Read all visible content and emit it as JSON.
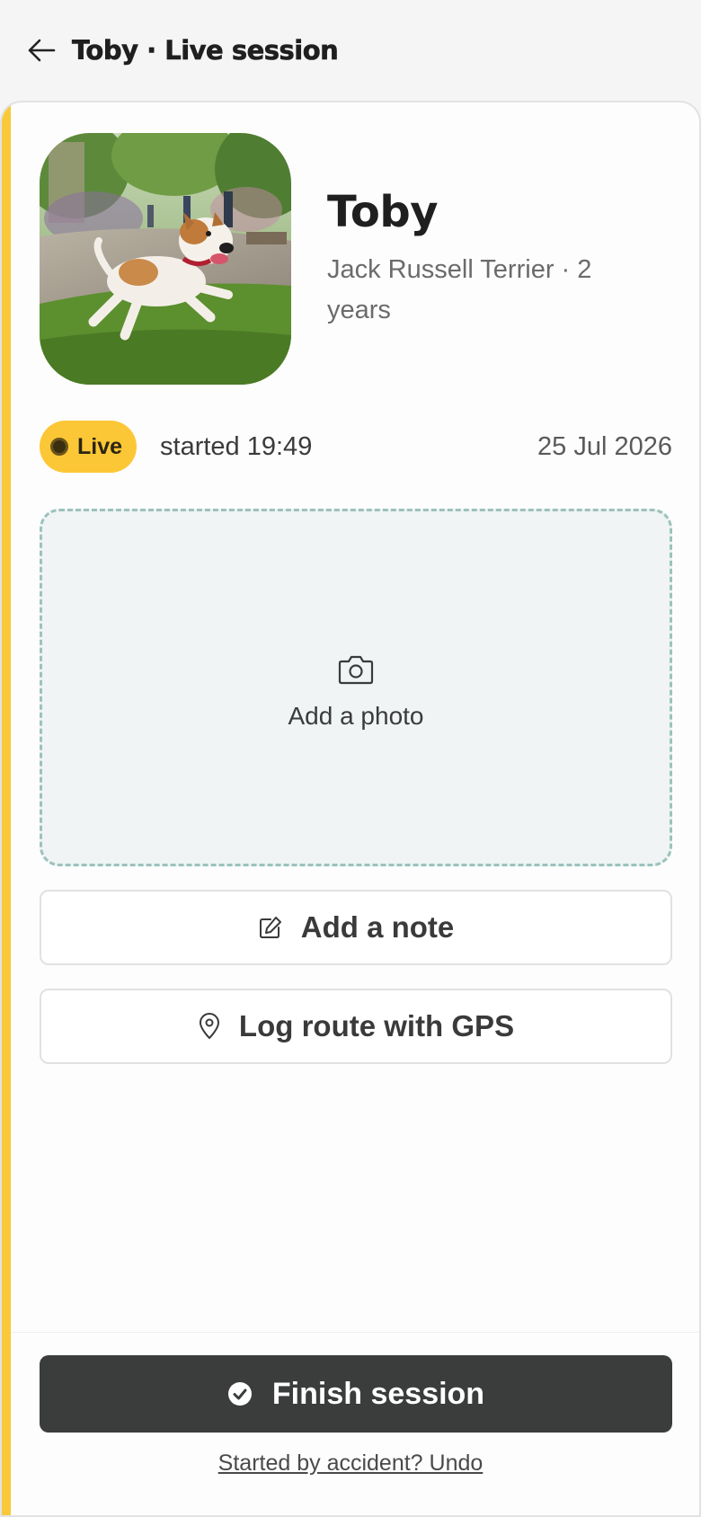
{
  "header": {
    "title": "Toby · Live session",
    "back_icon": "arrow-left-icon"
  },
  "profile": {
    "name": "Toby",
    "subtitle": "Jack Russell Terrier · 2 years",
    "photo_icon": "dog-photo"
  },
  "status": {
    "badge_label": "Live",
    "started": "started 19:49",
    "date": "25 Jul 2026"
  },
  "photo_upload": {
    "icon": "camera-icon",
    "label": "Add a photo"
  },
  "actions": {
    "note": {
      "icon": "edit-icon",
      "label": "Add a note"
    },
    "gps": {
      "icon": "map-pin-icon",
      "label": "Log route with GPS"
    }
  },
  "footer": {
    "finish_icon": "check-circle-icon",
    "finish_label": "Finish session",
    "undo_label": "Started by accident? Undo"
  },
  "colors": {
    "accent": "#f9c93a",
    "live_badge": "#fcc736",
    "finish_button": "#3b3c3c",
    "photo_drop_border": "#9cc2bd",
    "photo_drop_bg": "#f0f4f4"
  }
}
